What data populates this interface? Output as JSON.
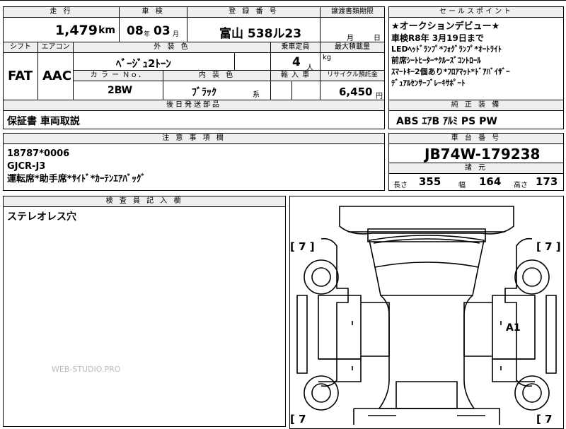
{
  "header": {
    "mileage_label": "走 行",
    "inspection_label": "車 検",
    "registration_label": "登 録 番 号",
    "transfer_label": "譲渡書類期限",
    "sales_label": "セールスポイント"
  },
  "mileage": {
    "value": "1,479",
    "unit": "km"
  },
  "inspection": {
    "year": "08",
    "year_unit": "年",
    "month": "03",
    "month_unit": "月"
  },
  "registration": {
    "number": "富山 538ル23"
  },
  "transfer": {
    "month_unit": "月",
    "day_unit": "日"
  },
  "sales_points": [
    "★オークションデビュー★",
    "車検R8年 3月19日まで",
    "LEDﾍｯﾄﾞﾗﾝﾌﾟ*ﾌｫｸﾞﾗﾝﾌﾟ*ｵｰﾄﾗｲﾄ",
    "前席ｼｰﾄﾋｰﾀｰ*ｸﾙｰｽﾞｺﾝﾄﾛｰﾙ",
    "ｽﾏｰﾄｷｰ2個あり*ﾌﾛｱﾏｯﾄ*ﾄﾞｱﾊﾞｲｻﾞｰ",
    "ﾃﾞｭｱﾙｾﾝｻｰﾌﾞﾚｰｷｻﾎﾟｰﾄ"
  ],
  "shift": {
    "label": "シフト",
    "value": "FAT"
  },
  "aircon": {
    "label": "エアコン",
    "value": "AAC"
  },
  "exterior": {
    "label": "外 装 色",
    "value": "ﾍﾞｰｼﾞｭ2ﾄｰﾝ"
  },
  "capacity": {
    "label": "乗車定員",
    "value": "4",
    "unit": "人"
  },
  "load": {
    "label": "最大積載量",
    "unit": "kg"
  },
  "color_no": {
    "label": "カ ラ ー Ｎｏ．",
    "value": "2BW"
  },
  "interior": {
    "label": "内 装 色",
    "value": "ﾌﾞﾗｯｸ",
    "suffix": "系"
  },
  "import": {
    "label": "輸 入 車"
  },
  "recycle": {
    "label": "リサイクル預託金",
    "value": "6,450",
    "unit": "円"
  },
  "later_parts": {
    "label": "後日発送部品",
    "value": "保証書 車両取説"
  },
  "standard": {
    "label": "純 正 装 備",
    "value": "ABS ｴｱB ｱﾙﾐ PS PW"
  },
  "notes": {
    "label": "注 意 事 項 欄",
    "lines": [
      "18787*0006",
      "GJCR-J3",
      "運転席*助手席*ｻｲﾄﾞ*ｶｰﾃﾝｴｱﾊﾞｯｸﾞ"
    ]
  },
  "chassis": {
    "label": "車 台 番 号",
    "value": "JB74W-179238"
  },
  "dims": {
    "label": "諸 元",
    "length_label": "長さ",
    "length": "355",
    "width_label": "幅",
    "width": "164",
    "height_label": "高さ",
    "height": "173"
  },
  "inspector": {
    "label": "検 査 員 記 入 欄",
    "value": "ステレオレス穴"
  },
  "diagram": {
    "mark_a1": "A1",
    "tire_tl": "[ 7 ]",
    "tire_tr": "[ 7 ]",
    "tire_bl": "[ 7",
    "tire_br": "[ 7"
  },
  "watermark": "WEB-STUDIO.PRO"
}
